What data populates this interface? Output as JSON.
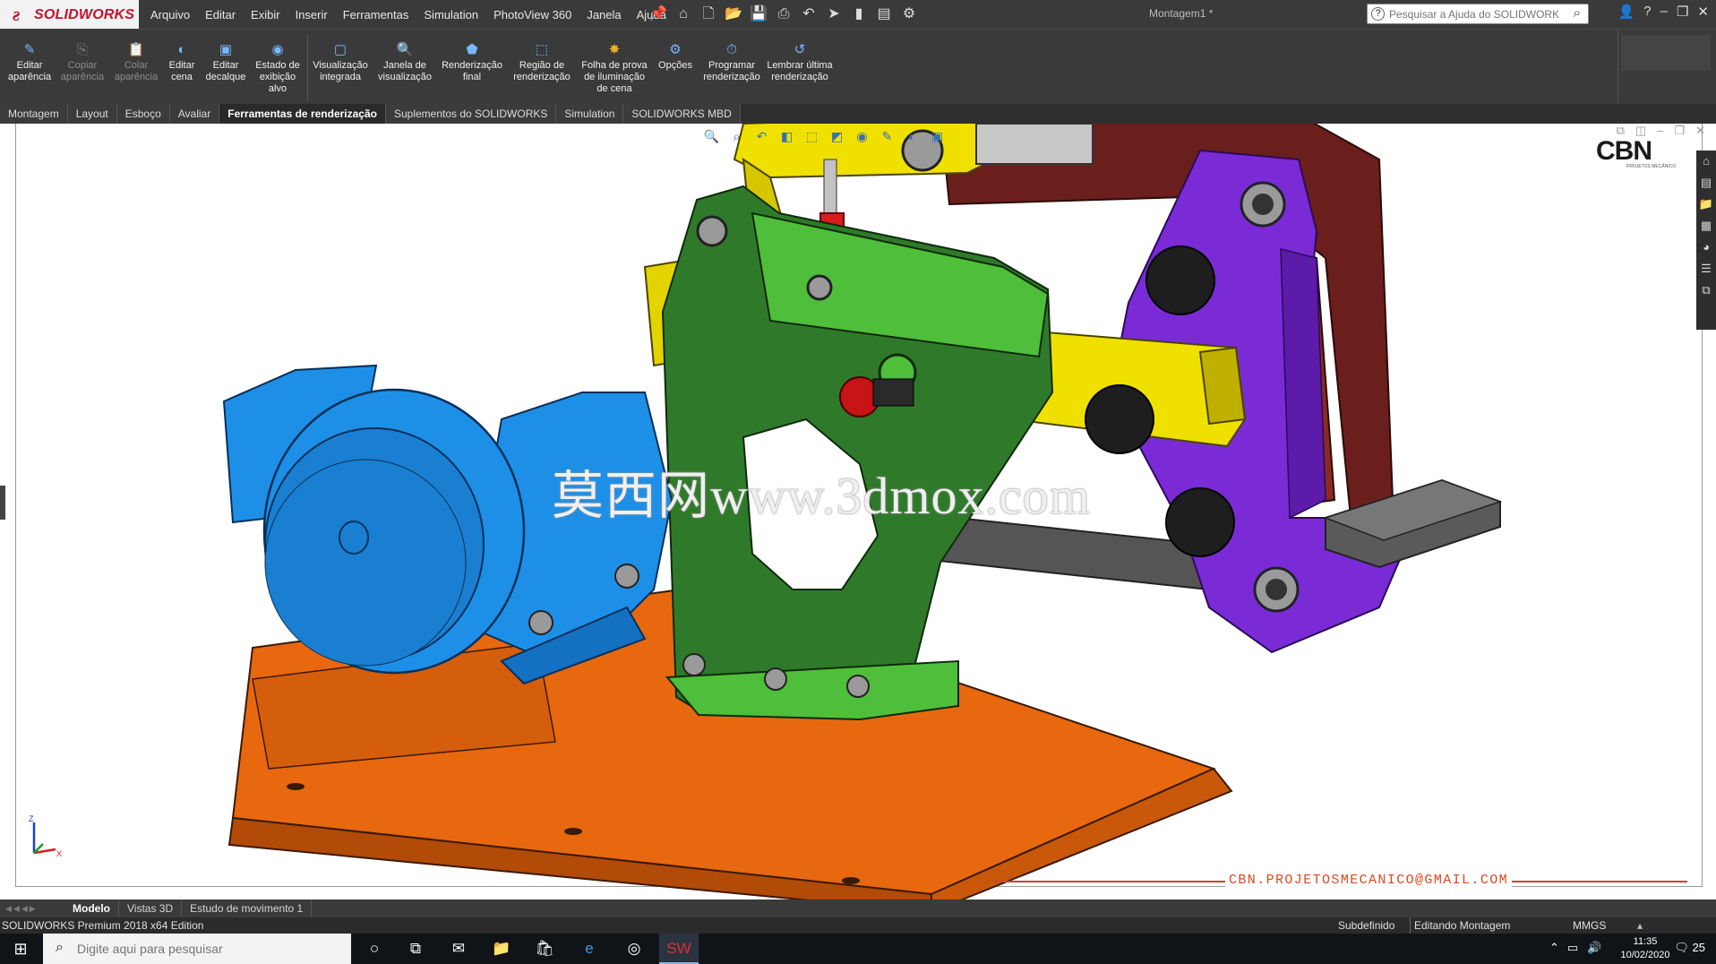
{
  "app": {
    "brand": "SOLIDWORKS",
    "document_title": "Montagem1 *",
    "menus": [
      "Arquivo",
      "Editar",
      "Exibir",
      "Inserir",
      "Ferramentas",
      "Simulation",
      "PhotoView 360",
      "Janela",
      "Ajuda"
    ],
    "help_search_placeholder": "Pesquisar a Ajuda do SOLIDWORKS"
  },
  "ribbon": {
    "buttons": [
      {
        "label": "Editar aparência",
        "icon": "edit-appearance-icon",
        "enabled": true
      },
      {
        "label": "Copiar aparência",
        "icon": "copy-appearance-icon",
        "enabled": false
      },
      {
        "label": "Colar aparência",
        "icon": "paste-appearance-icon",
        "enabled": false
      },
      {
        "label": "Editar cena",
        "icon": "edit-scene-icon",
        "enabled": true
      },
      {
        "label": "Editar decalque",
        "icon": "edit-decal-icon",
        "enabled": true
      },
      {
        "label": "Estado de exibição alvo",
        "icon": "display-state-icon",
        "enabled": true
      },
      {
        "label": "Visualização integrada",
        "icon": "integrated-preview-icon",
        "enabled": true
      },
      {
        "label": "Janela de visualização",
        "icon": "preview-window-icon",
        "enabled": true
      },
      {
        "label": "Renderização final",
        "icon": "final-render-icon",
        "enabled": true
      },
      {
        "label": "Região de renderização",
        "icon": "render-region-icon",
        "enabled": true
      },
      {
        "label": "Folha de prova de iluminação de cena",
        "icon": "scene-illumination-proof-icon",
        "enabled": true
      },
      {
        "label": "Opções",
        "icon": "options-icon",
        "enabled": true
      },
      {
        "label": "Programar renderização",
        "icon": "schedule-render-icon",
        "enabled": true
      },
      {
        "label": "Lembrar última renderização",
        "icon": "recall-last-render-icon",
        "enabled": true
      }
    ]
  },
  "tabs": [
    {
      "label": "Montagem",
      "active": false
    },
    {
      "label": "Layout",
      "active": false
    },
    {
      "label": "Esboço",
      "active": false
    },
    {
      "label": "Avaliar",
      "active": false
    },
    {
      "label": "Ferramentas de renderização",
      "active": true
    },
    {
      "label": "Suplementos do SOLIDWORKS",
      "active": false
    },
    {
      "label": "Simulation",
      "active": false
    },
    {
      "label": "SOLIDWORKS MBD",
      "active": false
    }
  ],
  "viewport": {
    "logo_text": "CBN",
    "logo_subtext": "PROJETOS MECÂNICO",
    "watermark": "莫西网www.3dmox.com",
    "email": "CBN.PROJETOSMECANICO@GMAIL.COM",
    "triad_labels": {
      "z": "Z",
      "x": "X"
    },
    "colors": {
      "motor": "#1e8fe6",
      "base": "#e8680f",
      "frame": "#2f7a2a",
      "arm": "#f0e000",
      "plate": "#7a2bd6",
      "belt": "#6b1f1c"
    }
  },
  "model_tabs": [
    {
      "label": "Modelo",
      "active": true
    },
    {
      "label": "Vistas 3D",
      "active": false
    },
    {
      "label": "Estudo de movimento 1",
      "active": false
    }
  ],
  "status": {
    "edition": "SOLIDWORKS Premium 2018 x64 Edition",
    "definition": "Subdefinido",
    "mode": "Editando Montagem",
    "units": "MMGS"
  },
  "taskbar": {
    "search_placeholder": "Digite aqui para pesquisar",
    "time": "11:35",
    "date": "10/02/2020",
    "notification_count": "25"
  }
}
